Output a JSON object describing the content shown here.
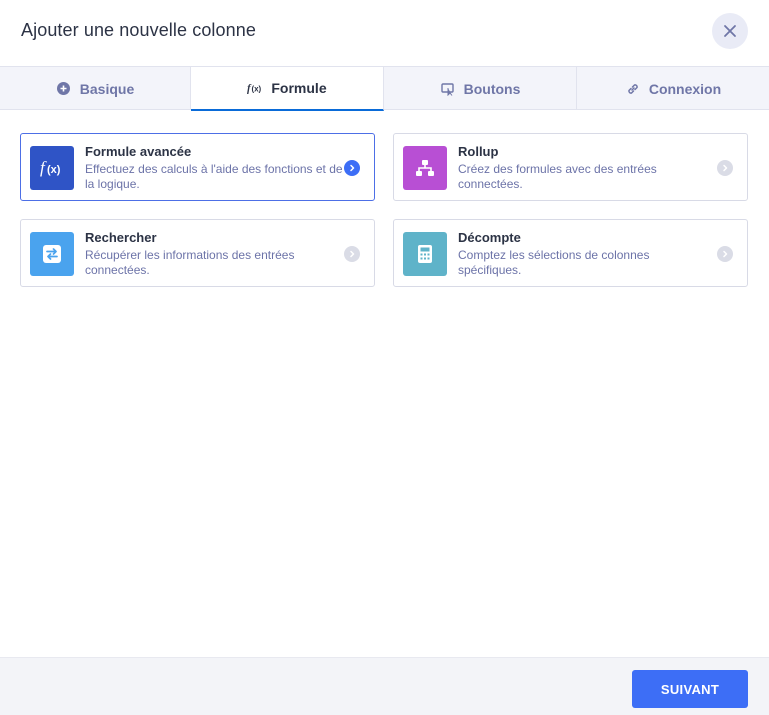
{
  "dialog": {
    "title": "Ajouter une nouvelle colonne",
    "close_icon": "close-icon"
  },
  "tabs": [
    {
      "label": "Basique",
      "icon": "plus-circle-icon",
      "active": false
    },
    {
      "label": "Formule",
      "icon": "function-icon",
      "active": true
    },
    {
      "label": "Boutons",
      "icon": "button-cursor-icon",
      "active": false
    },
    {
      "label": "Connexion",
      "icon": "link-icon",
      "active": false
    }
  ],
  "cards": [
    {
      "title": "Formule avancée",
      "description": "Effectuez des calculs à l'aide des fonctions et de la logique.",
      "icon": "function-icon",
      "icon_color": "#2f54c6",
      "selected": true
    },
    {
      "title": "Rollup",
      "description": "Créez des formules avec des entrées connectées.",
      "icon": "hierarchy-icon",
      "icon_color": "#b84fd4",
      "selected": false
    },
    {
      "title": "Rechercher",
      "description": "Récupérer les informations des entrées connectées.",
      "icon": "swap-arrows-icon",
      "icon_color": "#4aa3ee",
      "selected": false
    },
    {
      "title": "Décompte",
      "description": "Comptez les sélections de colonnes spécifiques.",
      "icon": "calculator-icon",
      "icon_color": "#5fb3c9",
      "selected": false
    }
  ],
  "colors": {
    "accent": "#3d6ef6",
    "tab_active_border": "#0a6bd8",
    "arrow_active": "#3d6ef6",
    "arrow_inactive": "#dadce6"
  },
  "footer": {
    "next_label": "SUIVANT"
  }
}
